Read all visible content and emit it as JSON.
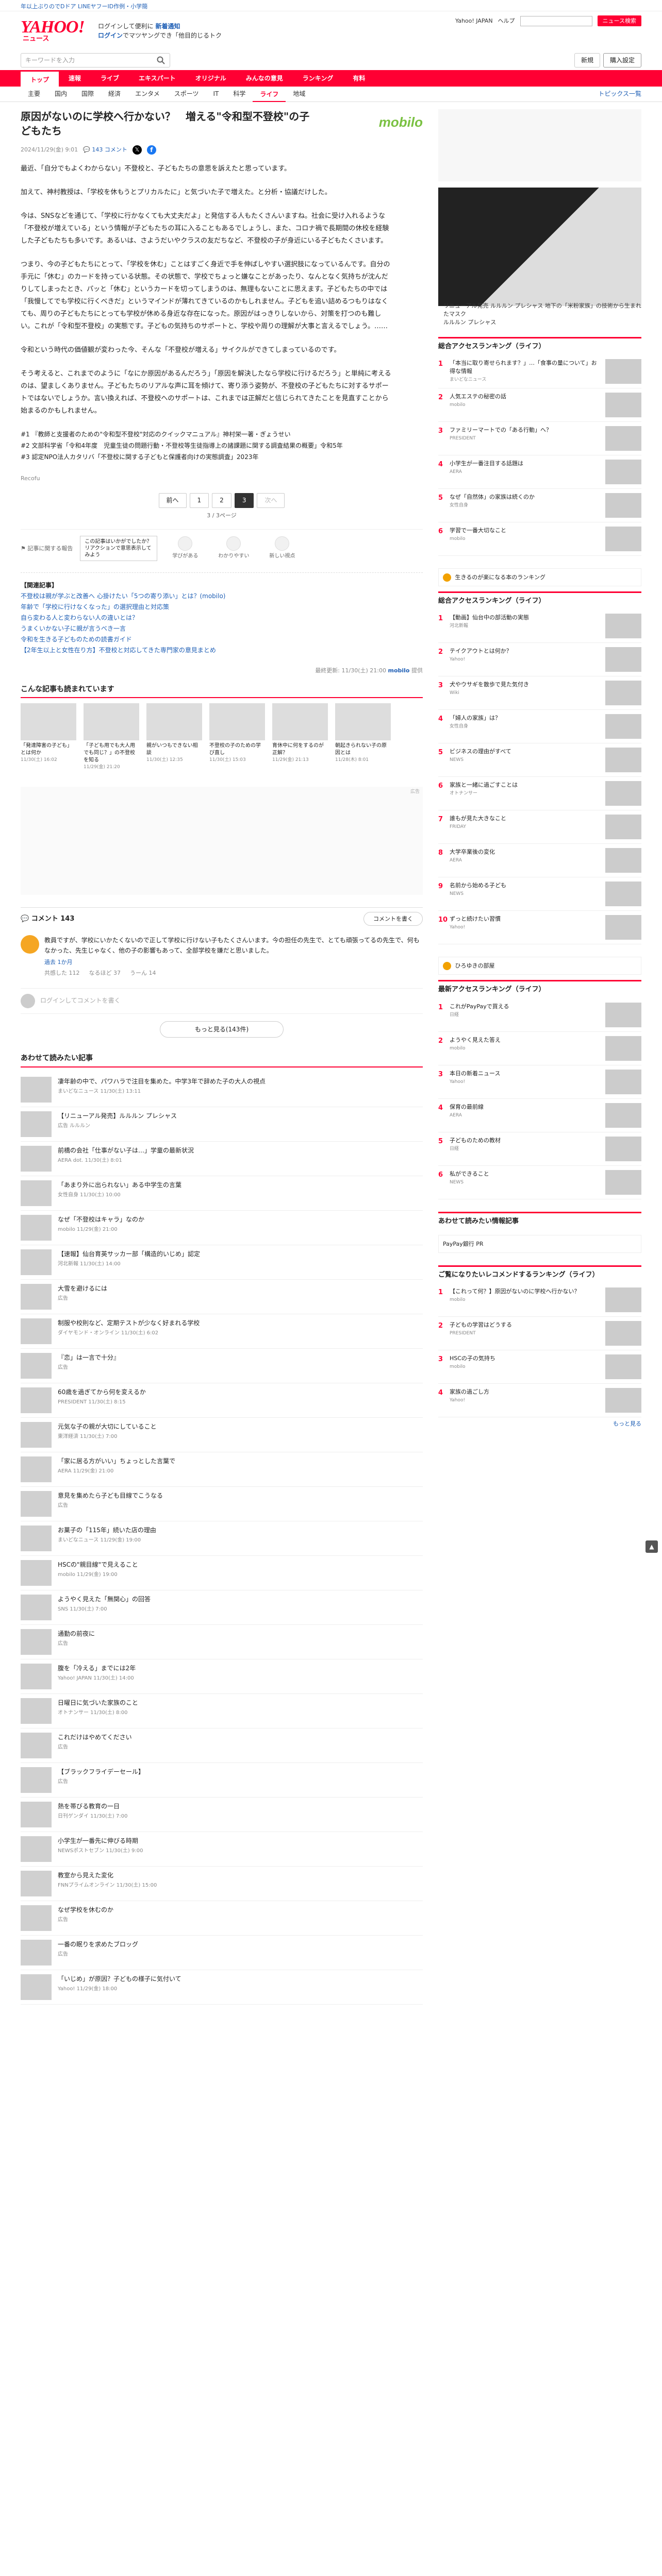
{
  "topstrip": {
    "text": "年以上ぶりのでDドア LINEヤフーID作例・小学簡"
  },
  "header": {
    "logo": "YAHOO!",
    "logo_sub": "ニュース",
    "promo1_prefix": "ログインして便利に",
    "promo1_link": "新着通知",
    "promo2_prefix": "ログイン",
    "promo2_link": "でマツヤングでき「他目的じるトク",
    "links": [
      "Yahoo! JAPAN",
      "ヘルプ"
    ],
    "input_value": "",
    "search_label": "ニュース検索"
  },
  "searchbar": {
    "placeholder": "キーワードを入力",
    "right_buttons": [
      "新規",
      "購入設定"
    ]
  },
  "categories": [
    "トップ",
    "速報",
    "ライブ",
    "エキスパート",
    "オリジナル",
    "みんなの意見",
    "ランキング",
    "有料"
  ],
  "subnav": {
    "items": [
      "主要",
      "国内",
      "国際",
      "経済",
      "エンタメ",
      "スポーツ",
      "IT",
      "科学",
      "ライフ",
      "地域"
    ],
    "active_index": 8,
    "topics": "トピックス一覧"
  },
  "article": {
    "title": "原因がないのに学校へ行かない？　増える\"令和型不登校\"の子どもたち",
    "brand": "mobilo",
    "date": "2024/11/29(金) 9:01",
    "comment_count": "143",
    "comment_label": "コメント",
    "paragraphs": [
      "最近、「自分でもよくわからない」不登校と、子どもたちの意思を訴えたと思っています。",
      "加えて、神村教授は、「学校を休もうとプリカルたに」と気づいた子で増えた。と分析・協議だけした。",
      "今は、SNSなどを通じて、「学校に行かなくても大丈夫だよ」と発信する人もたくさんいますね。社会に受け入れるような「不登校が増えている」という情報が子どもたちの耳に入ることもあるでしょうし、また、コロナ禍で長期間の休校を経験した子どもたちも多いです。あるいは、さようだいやクラスの友だちなど、不登校の子が身近にいる子どもたくさいます。",
      "つまり、今の子どもたちにとって、「学校を休む」ことはすごく身近で手を伸ばしやすい選択肢になっているんです。自分の手元に「休む」のカードを持っている状態。その状態で、学校でちょっと嫌なことがあったり、なんとなく気持ちが沈んだりしてしまったとき、パッと「休む」というカードを切ってしまうのは、無理もないことに思えます。子どもたちの中では「我慢してでも学校に行くべきだ」というマインドが薄れてきているのかもしれません。子どもを追い詰めるつもりはなくても、周りの子どもたちにとっても学校が休める身近な存在になった。原因がはっきりしないから、対策を打つのも難しい。これが「令和型不登校」の実態です。子どもの気持ちのサポートと、学校や周りの理解が大事と言えるでしょう。……",
      "令和という時代の価値観が変わった今、そんな「不登校が増える」サイクルができてしまっているのです。",
      "そう考えると、これまでのように「なにか原因があるんだろう」「原因を解決したなら学校に行けるだろう」と単純に考えるのは、望ましくありません。子どもたちのリアルな声に耳を傾けて、寄り添う姿勢が、不登校の子どもたちに対するサポートではないでしょうか。言い換えれば、不登校へのサポートは、これまでは正解だと信じられてきたことを見直すことから始まるのかもしれません。"
    ],
    "refs": [
      "#1 『教師と支援者のための\"令和型不登校\"対応のクイックマニュアル』神村栄一著・ぎょうせい",
      "#2 文部科学省「令和4年度　児童生徒の問題行動・不登校等生徒指導上の諸課題に関する調査結果の概要」令和5年",
      "#3 認定NPO法人カタリバ「不登校に関する子どもと保護者向けの実態調査」2023年"
    ],
    "recofu": "Recofu"
  },
  "pager": {
    "prev": "前へ",
    "pages": [
      "1",
      "2",
      "3"
    ],
    "current_index": 2,
    "next": "次へ",
    "note": "3 / 3ページ"
  },
  "feedback": {
    "label": "記事に関する報告",
    "tip": "この記事はいかがでしたか？リアクションで意思表示してみよう",
    "reactions": [
      "学びがある",
      "わかりやすい",
      "新しい視点"
    ]
  },
  "related": {
    "title": "【関連記事】",
    "links": [
      "不登校は親が学ぶと改善へ 心掛けたい「5つの寄り添い」とは？(mobilo)",
      "年齢で「学校に行けなくなった」の選択理由と対応策",
      "自ら変わる人と変わらない人の違いとは？",
      "うまくいかない子に親が言うべき一言",
      "令和を生きる子どものための読書ガイド",
      "【2年生以上と女性在り方】不登校と対応してきた専門家の意見まとめ"
    ]
  },
  "signature": {
    "date": "最終更新: 11/30(土) 21:00",
    "source": "mobilo",
    "by": "提供"
  },
  "recommend": {
    "title": "こんな記事も読まれています",
    "cards": [
      {
        "title": "「発達障害の子ども」とは何か",
        "meta": "11/30(土) 16:02"
      },
      {
        "title": "「子ども用でも大人用でも同じ？」の不登校を知る",
        "meta": "11/29(金) 21:20"
      },
      {
        "title": "親がいつもできない相談",
        "meta": "11/30(土) 12:35"
      },
      {
        "title": "不登校の子のための学び直し",
        "meta": "11/30(土) 15:03"
      },
      {
        "title": "育休中に何をするのが正解？",
        "meta": "11/29(金) 21:13"
      },
      {
        "title": "朝起きられない子の原因とは",
        "meta": "11/28(木) 8:01"
      }
    ]
  },
  "ad_label": "広告",
  "comments": {
    "heading": "コメント",
    "count": "143",
    "post_btn": "コメントを書く",
    "item": {
      "text": "教員ですが、学校にいかたくないので正して学校に行けない子もたくさんいます。今の担任の先生で、とても頑張ってるの先生で、何もなかった、先生じゃなく、他の子の影響もあって、全部学校を嫌だと思いました。",
      "user": "過去 1か月",
      "actions": [
        "共感した 112",
        "なるほど 37",
        "うーん 14"
      ]
    },
    "placeholder": "ログインしてコメントを書く",
    "more": "もっと見る(143件)"
  },
  "articles": {
    "title": "あわせて読みたい記事",
    "items": [
      {
        "title": "凄年齢の中で、パワハラで注目を集めた。中学3年で辞めた子の大人の視点",
        "meta": "まいどなニュース 11/30(土) 13:11"
      },
      {
        "title": "【リニューアル発売】ルルルン プレシャス",
        "meta": "広告 ルルルン"
      },
      {
        "title": "前橋の会社「仕事がない子は…」学童の最新状況",
        "meta": "AERA dot. 11/30(土) 8:01"
      },
      {
        "title": "「あまり外に出られない」ある中学生の言葉",
        "meta": "女性自身 11/30(土) 10:00"
      },
      {
        "title": "なぜ「不登校はキャラ」なのか",
        "meta": "mobilo 11/29(金) 21:00"
      },
      {
        "title": "【速報】仙台育英サッカー部「構造的いじめ」認定",
        "meta": "河北新報 11/30(土) 14:00"
      },
      {
        "title": "大雪を避けるには",
        "meta": "広告"
      },
      {
        "title": "制服や校則など、定期テストが少なく好まれる学校",
        "meta": "ダイヤモンド・オンライン 11/30(土) 6:02"
      },
      {
        "title": "『恋」は一言で十分』",
        "meta": "広告"
      },
      {
        "title": "60歳を過ぎてから何を変えるか",
        "meta": "PRESIDENT 11/30(土) 8:15"
      },
      {
        "title": "元気な子の親が大切にしていること",
        "meta": "東洋経済 11/30(土) 7:00"
      },
      {
        "title": "「家に居る方がいい」ちょっとした言葉で",
        "meta": "AERA 11/29(金) 21:00"
      },
      {
        "title": "意見を集めたら子ども目線でこうなる",
        "meta": "広告"
      },
      {
        "title": "お菓子の「115年」続いた店の理由",
        "meta": "まいどなニュース 11/29(金) 19:00"
      },
      {
        "title": "HSCの\"親目線\"で見えること",
        "meta": "mobilo 11/29(金) 19:00"
      },
      {
        "title": "ようやく見えた「無関心」の回答",
        "meta": "SNS 11/30(土) 7:00"
      },
      {
        "title": "通勤の前夜に",
        "meta": "広告"
      },
      {
        "title": "腹を「冷える」までには2年",
        "meta": "Yahoo! JAPAN 11/30(土) 14:00"
      },
      {
        "title": "日曜日に気づいた家族のこと",
        "meta": "オトナンサー 11/30(土) 8:00"
      },
      {
        "title": "これだけはやめてください",
        "meta": "広告"
      },
      {
        "title": "【ブラックフライデーセール】",
        "meta": "広告"
      },
      {
        "title": "熱を帯びる教育の一日",
        "meta": "日刊ゲンダイ 11/30(土) 7:00"
      },
      {
        "title": "小学生が一番先に伸びる時期",
        "meta": "NEWSポストセブン 11/30(土) 9:00"
      },
      {
        "title": "教室から見えた変化",
        "meta": "FNNプライムオンライン 11/30(土) 15:00"
      },
      {
        "title": "なぜ学校を休むのか",
        "meta": "広告"
      },
      {
        "title": "一番の眠りを求めたブロッグ",
        "meta": "広告"
      },
      {
        "title": "「いじめ」が原因？子どもの様子に気付いて",
        "meta": "Yahoo! 11/29(金) 18:00"
      }
    ]
  },
  "sidebar": {
    "ad_caption": "リニューアル発売 ルルルン プレシャス 地下の「米粉家族」の技術から生まれたマスク",
    "ad_sponsor": "ルルルン プレシャス",
    "rank1_title": "総合アクセスランキング（ライフ）",
    "rank1": [
      {
        "t": "「本当に取り寄せられます？」…「食事の量について」お得な情報",
        "m": "まいどなニュース"
      },
      {
        "t": "人気エステの秘密の話",
        "m": "mobilo"
      },
      {
        "t": "ファミリーマートでの「ある行動」へ？",
        "m": "PRESIDENT"
      },
      {
        "t": "小学生が一番注目する話題は",
        "m": "AERA"
      },
      {
        "t": "なぜ「自然体」の家族は続くのか",
        "m": "女性自身"
      },
      {
        "t": "学習で一番大切なこと",
        "m": "mobilo"
      }
    ],
    "promo1": "生きるのが楽になる本のランキング",
    "rank2_title": "総合アクセスランキング（ライフ）",
    "rank2": [
      {
        "t": "【動画】仙台中の部活動の実態",
        "m": "河北新報"
      },
      {
        "t": "テイクアウトとは何か？",
        "m": "Yahoo!"
      },
      {
        "t": "犬やウサギを散歩で見た気付き",
        "m": "Wiki"
      },
      {
        "t": "「婦人の家族」は？",
        "m": "女性自身"
      },
      {
        "t": "ビジネスの理由がすべて",
        "m": "NEWS"
      },
      {
        "t": "家族と一緒に過ごすことは",
        "m": "オトナンサー"
      },
      {
        "t": "誰もが見た大きなこと",
        "m": "FRIDAY"
      },
      {
        "t": "大学卒業後の変化",
        "m": "AERA"
      },
      {
        "t": "名前から始める子ども",
        "m": "NEWS"
      },
      {
        "t": "ずっと続けたい習慣",
        "m": "Yahoo!"
      }
    ],
    "promo2": "ひろゆきの部屋",
    "rank3_title": "最新アクセスランキング（ライフ）",
    "rank3": [
      {
        "t": "これがPayPayで買える",
        "m": "日経"
      },
      {
        "t": "ようやく見えた答え",
        "m": "mobilo"
      },
      {
        "t": "本日の新着ニュース",
        "m": "Yahoo!"
      },
      {
        "t": "保育の最前線",
        "m": "AERA"
      },
      {
        "t": "子どものための教材",
        "m": "日経"
      },
      {
        "t": "私ができること",
        "m": "NEWS"
      }
    ],
    "promo3_title": "あわせて読みたい情報記事",
    "promo3_sub": "PayPay銀行 PR",
    "rank4_title": "ご覧になりたいレコメンドするランキング（ライフ）",
    "rank4": [
      {
        "t": "【これって何？】原因がないのに学校へ行かない？",
        "m": "mobilo"
      },
      {
        "t": "子どもの学習はどうする",
        "m": "PRESIDENT"
      },
      {
        "t": "HSCの子の気持ち",
        "m": "mobilo"
      },
      {
        "t": "家族の過ごし方",
        "m": "Yahoo!"
      }
    ],
    "more": "もっと見る"
  }
}
